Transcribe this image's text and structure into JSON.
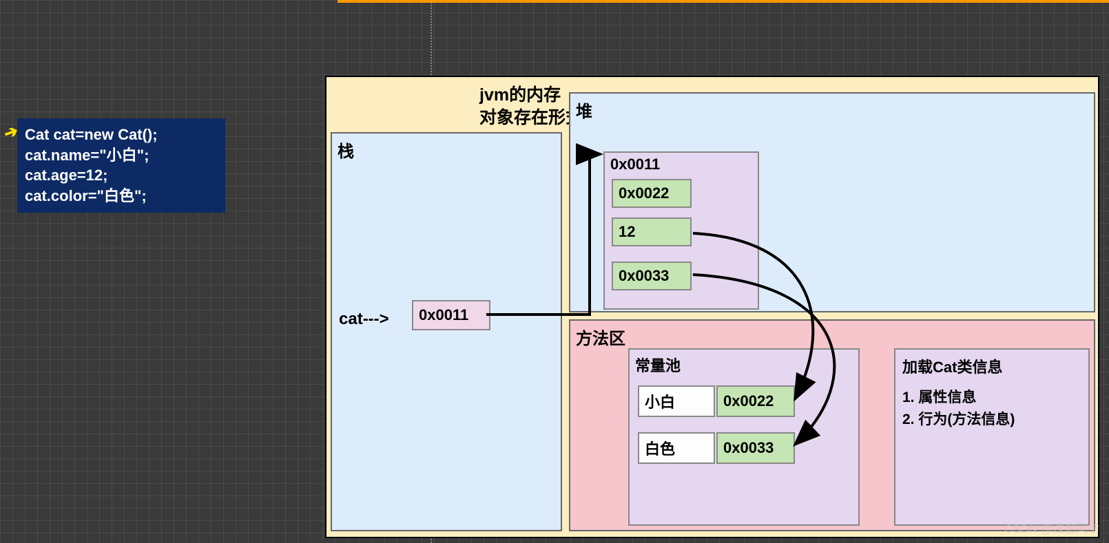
{
  "code": {
    "line1": "Cat cat=new Cat();",
    "line2": "cat.name=\"小白\";",
    "line3": "cat.age=12;",
    "line4": "cat.color=\"白色\";"
  },
  "jvm": {
    "title_line1": "jvm的内存",
    "title_line2": "对象存在形式"
  },
  "stack": {
    "label": "栈",
    "var": "cat--->",
    "addr": "0x0011"
  },
  "heap": {
    "label": "堆",
    "obj_addr": "0x0011",
    "field1": "0x0022",
    "field2": "12",
    "field3": "0x0033"
  },
  "method_area": {
    "label": "方法区",
    "const_pool": {
      "label": "常量池",
      "row1_val": "小白",
      "row1_addr": "0x0022",
      "row2_val": "白色",
      "row2_addr": "0x0033"
    },
    "class_info": {
      "title": "加载Cat类信息",
      "body": "1. 属性信息\n2. 行为(方法信息)"
    }
  },
  "watermark": "CSDN @浅念同学"
}
